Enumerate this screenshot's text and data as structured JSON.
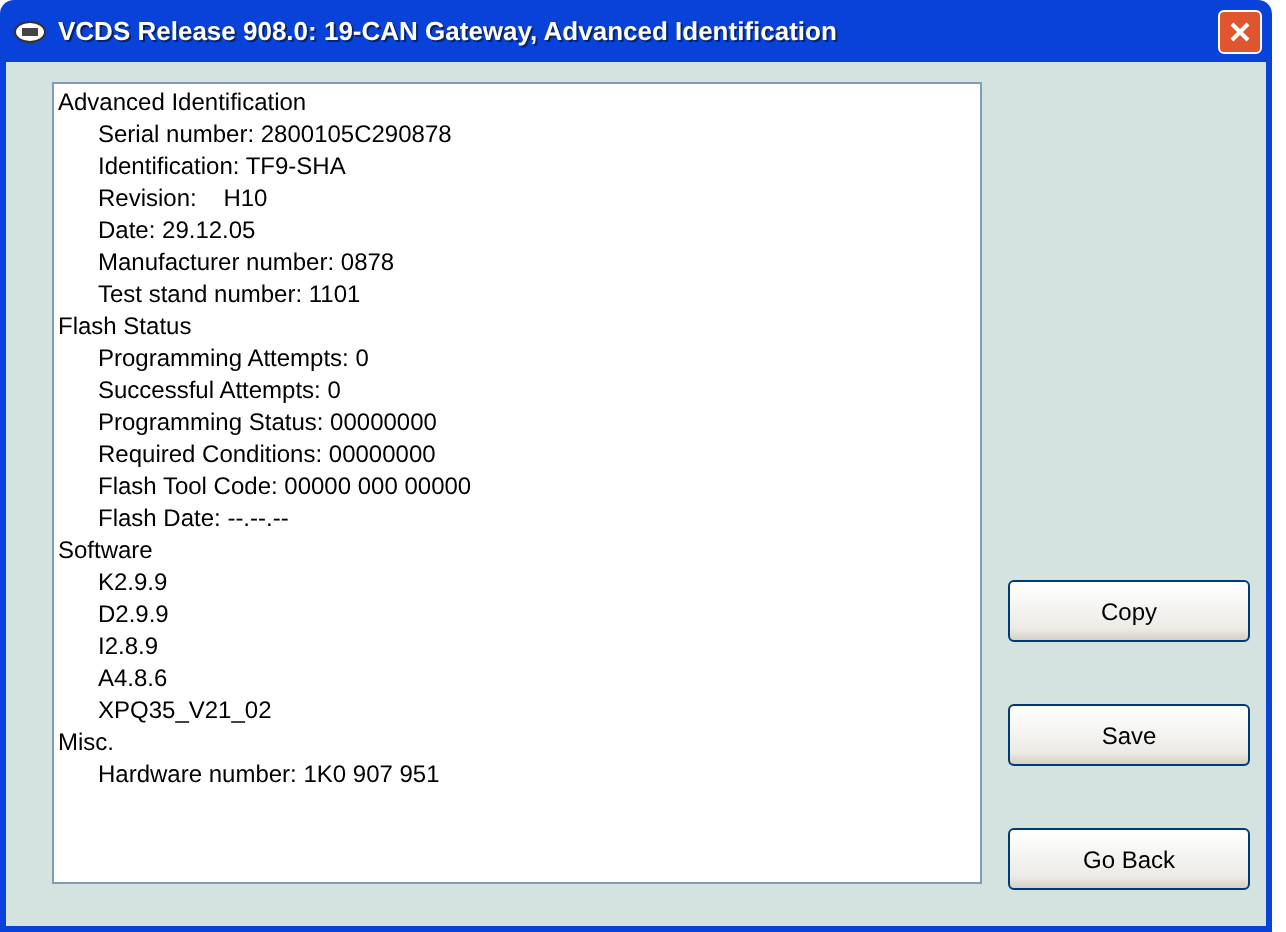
{
  "window": {
    "title": "VCDS Release 908.0: 19-CAN Gateway,  Advanced Identification"
  },
  "sections": [
    {
      "heading": "Advanced Identification",
      "children": [
        "Serial number: 2800105C290878",
        "Identification: TF9-SHA",
        "Revision:    H10",
        "Date: 29.12.05",
        "Manufacturer number: 0878",
        "Test stand number: 1101"
      ]
    },
    {
      "heading": "Flash Status",
      "children": [
        "Programming Attempts: 0",
        "Successful Attempts: 0",
        "Programming Status: 00000000",
        "Required Conditions: 00000000",
        "Flash Tool Code: 00000 000 00000",
        "Flash Date: --.--.--"
      ]
    },
    {
      "heading": "Software",
      "children": [
        "K2.9.9",
        "D2.9.9",
        "I2.8.9",
        "A4.8.6",
        "XPQ35_V21_02"
      ]
    },
    {
      "heading": "Misc.",
      "children": [
        "Hardware number: 1K0 907 951"
      ]
    }
  ],
  "buttons": [
    "Copy",
    "Save",
    "Go Back"
  ]
}
